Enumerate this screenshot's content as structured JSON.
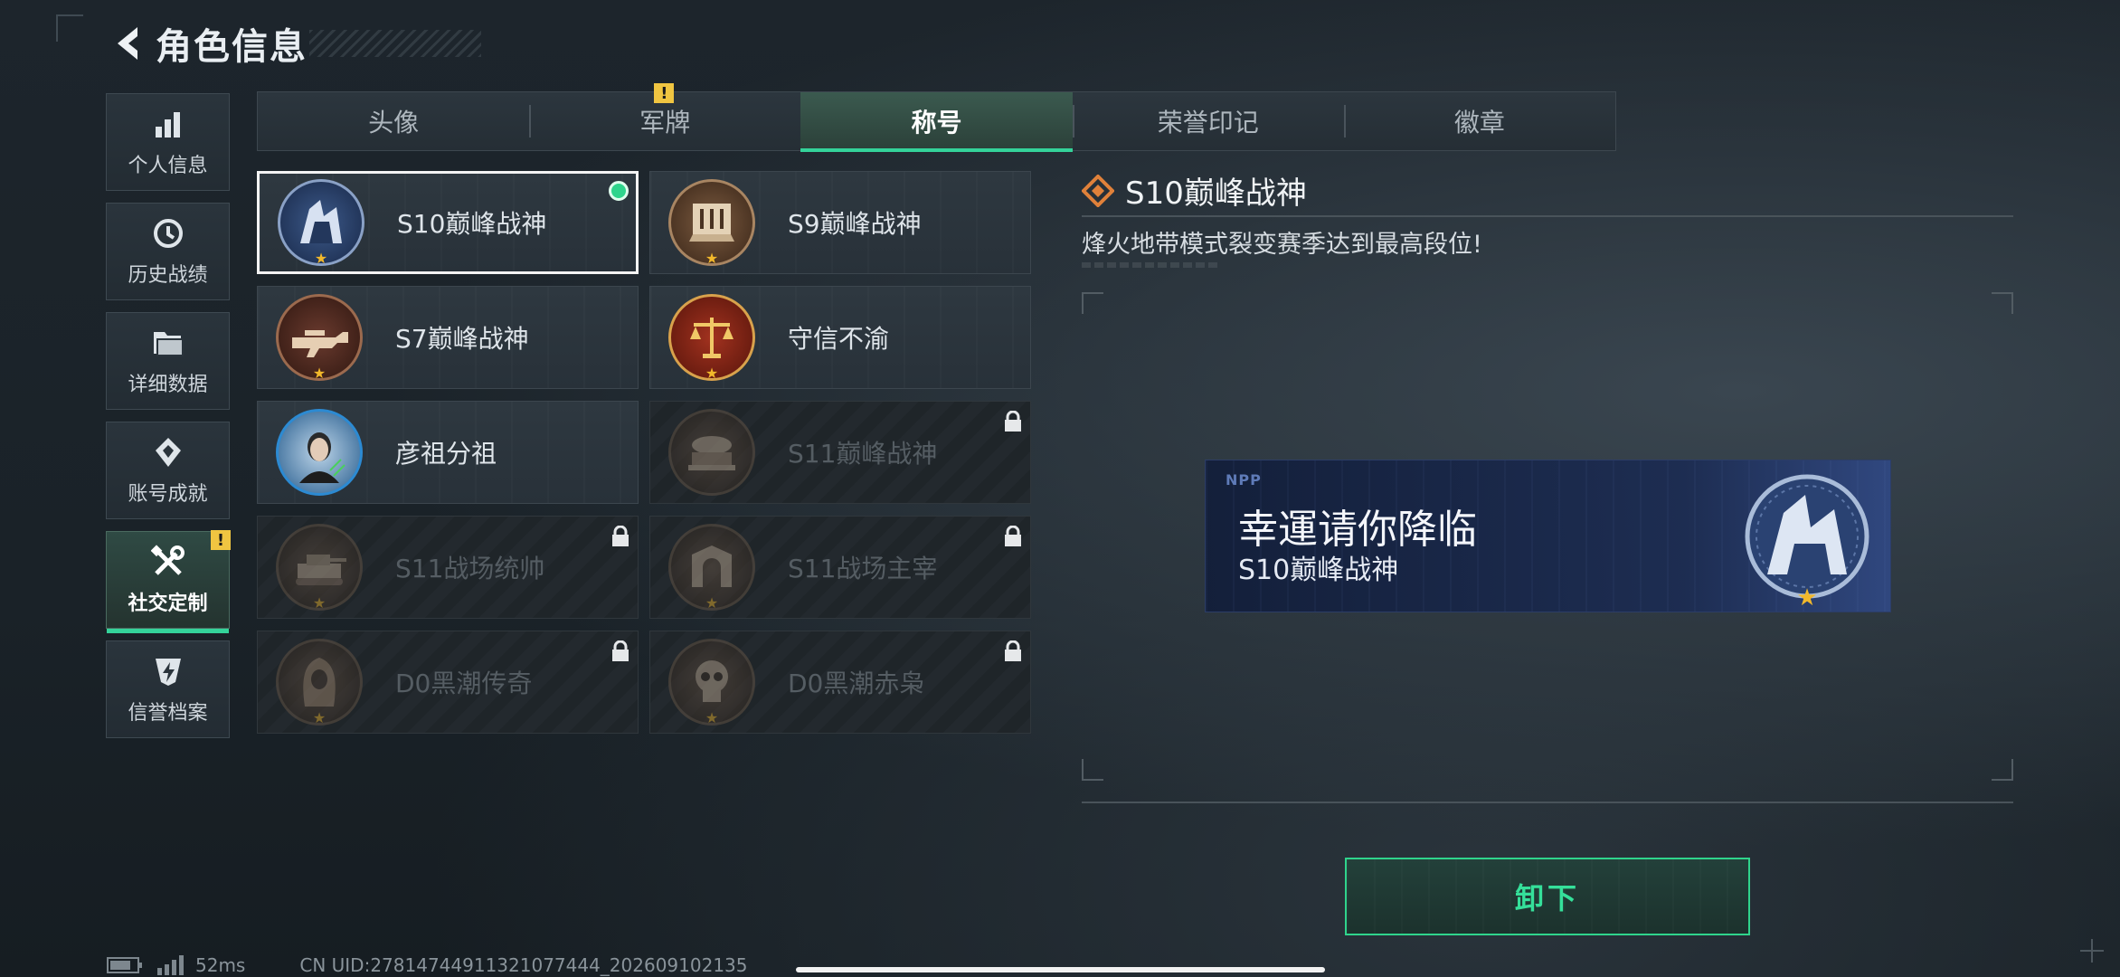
{
  "header": {
    "title": "角色信息"
  },
  "sidebar": {
    "items": [
      {
        "label": "个人信息",
        "icon": "bar-chart-icon"
      },
      {
        "label": "历史战绩",
        "icon": "clock-icon"
      },
      {
        "label": "详细数据",
        "icon": "folder-icon"
      },
      {
        "label": "账号成就",
        "icon": "medal-icon"
      },
      {
        "label": "社交定制",
        "icon": "tools-icon",
        "active": true,
        "badge": "!"
      },
      {
        "label": "信誉档案",
        "icon": "shield-bolt-icon"
      }
    ]
  },
  "tabs": [
    {
      "label": "头像"
    },
    {
      "label": "军牌",
      "badge": "!"
    },
    {
      "label": "称号",
      "active": true
    },
    {
      "label": "荣誉印记"
    },
    {
      "label": "徽章"
    }
  ],
  "titles": [
    {
      "name": "S10巅峰战神",
      "selected": true,
      "equipped": true,
      "locked": false
    },
    {
      "name": "S9巅峰战神",
      "locked": false
    },
    {
      "name": "S7巅峰战神",
      "locked": false
    },
    {
      "name": "守信不渝",
      "locked": false
    },
    {
      "name": "彦祖分祖",
      "locked": false
    },
    {
      "name": "S11巅峰战神",
      "locked": true
    },
    {
      "name": "S11战场统帅",
      "locked": true
    },
    {
      "name": "S11战场主宰",
      "locked": true
    },
    {
      "name": "D0黑潮传奇",
      "locked": true
    },
    {
      "name": "D0黑潮赤枭",
      "locked": true
    }
  ],
  "detail": {
    "title": "S10巅峰战神",
    "description": "烽火地带模式裂变赛季达到最高段位!",
    "banner": {
      "nickname": "幸運请你降临",
      "title": "S10巅峰战神",
      "logo": "NPP"
    },
    "action_label": "卸下"
  },
  "footer": {
    "ping": "52ms",
    "uid": "CN UID:27814744911321077444_202609102135"
  },
  "colors": {
    "accent": "#34d39a",
    "warning": "#f0c541",
    "star": "#f2b82b"
  }
}
